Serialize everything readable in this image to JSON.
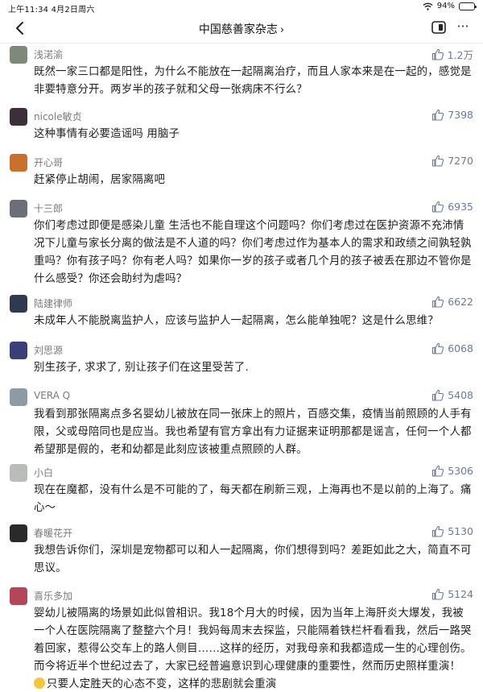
{
  "status_bar": {
    "time": "上午11:34  4月2日周六",
    "battery": "94%",
    "battery_level": 0.94
  },
  "nav": {
    "title": "中国慈善家杂志",
    "title_chevron": "›",
    "more": "···"
  },
  "colors": {
    "link_blue": "#6b7a99",
    "name_gray": "#7a7a7a",
    "text": "#1e1e1e"
  },
  "comments": [
    {
      "name": "浅渃渝",
      "likes": "1.2万",
      "avatar_color": "#7d8a7a",
      "text": "既然一家三口都是阳性，为什么不能放在一起隔离治疗，而且人家本来是在一起的，感觉是非要特意分开。两岁半的孩子就和父母一张病床不行么？"
    },
    {
      "name": "nicole敏贞",
      "likes": "7398",
      "avatar_color": "#3b2f3a",
      "text": "这种事情有必要造谣吗 用脑子"
    },
    {
      "name": "开心哥",
      "likes": "7270",
      "avatar_color": "#c9702e",
      "text": "赶紧停止胡闹，居家隔离吧"
    },
    {
      "name": "十三郎",
      "likes": "6935",
      "avatar_color": "#6b6f77",
      "text": "你们考虑过即便是感染儿童 生活也不能自理这个问题吗？你们考虑过在医护资源不充沛情况下儿童与家长分离的做法是不人道的吗？你们考虑过作为基本人的需求和政绩之间孰轻孰重吗？你有孩子吗？你有老人吗？如果你一岁的孩子或者几个月的孩子被丢在那边不管你是什么感受？你还会助纣为虐吗？"
    },
    {
      "name": "陆建律师",
      "likes": "6622",
      "avatar_color": "#2d3a4f",
      "text": "未成年人不能脱离监护人，应该与监护人一起隔离，怎么能单独呢？这是什么思维？"
    },
    {
      "name": "刘思源",
      "likes": "6068",
      "avatar_color": "#3a3f7a",
      "text": "别生孩子, 求求了, 别让孩子们在这里受苦了."
    },
    {
      "name": "VERA Q",
      "likes": "5408",
      "avatar_color": "#8e9aa5",
      "text": "我看到那张隔离点多名婴幼儿被放在同一张床上的照片，百感交集，疫情当前照顾的人手有限，父或母陪同也是应当。我也希望有官方拿出有力证据来证明那都是谣言，任何一个人都希望那是假的，老和幼都是此刻应该被重点照顾的人群。"
    },
    {
      "name": "小白",
      "likes": "5306",
      "avatar_color": "#b9bcb8",
      "text": "现在在魔都，没有什么是不可能的了，每天都在刷新三观，上海再也不是以前的上海了。痛心～"
    },
    {
      "name": "春暖花开",
      "likes": "5130",
      "avatar_color": "#2a2a2a",
      "text": "我想告诉你们，深圳是宠物都可以和人一起隔离，你们想得到吗？差距如此之大，简直不可思议。"
    },
    {
      "name": "喜乐多加",
      "likes": "5124",
      "avatar_color": "#b5455a",
      "text": "婴幼儿被隔离的场景如此似曾相识。我18个月大的时候，因为当年上海肝炎大爆发，我被一个人在医院隔离了整整六个月！我妈每周末去探监，只能隔着铁栏杆看看我，然后一路哭着回家，惹得公交车上的路人侧目……这样的经历，对我母亲和我都造成一生的心理创伤。而今将近半个世纪过去了，大家已经普遍意识到心理健康的重要性，然而历史照样重演！",
      "text_tail": "只要人定胜天的心态不变，这样的悲剧就会重演"
    }
  ]
}
